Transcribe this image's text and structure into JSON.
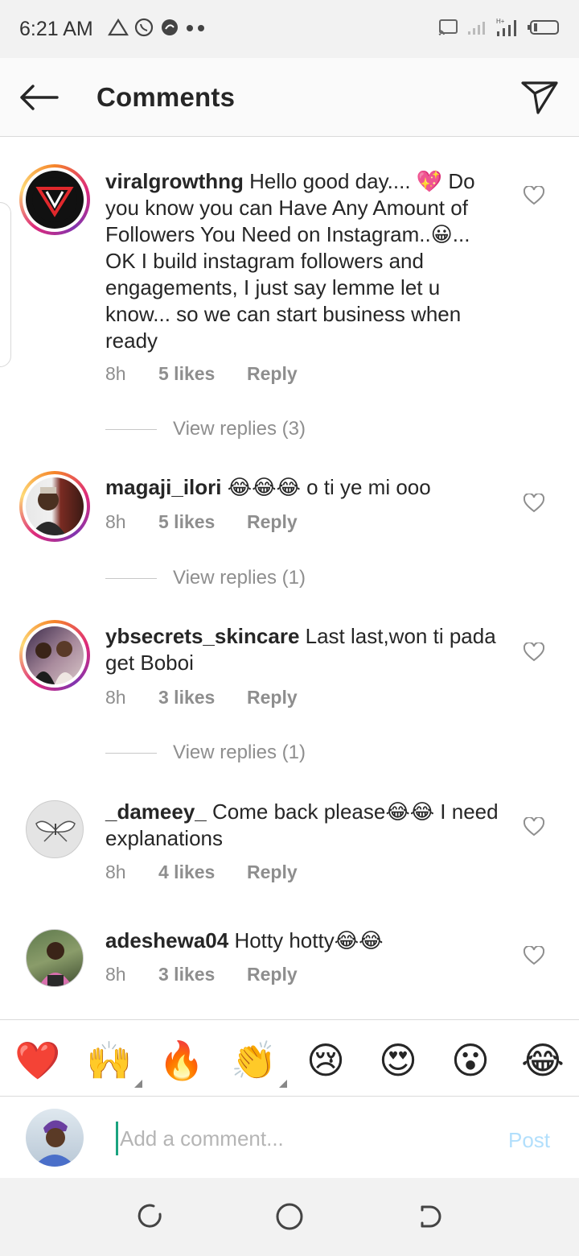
{
  "status_bar": {
    "time": "6:21 AM",
    "notification_icons": [
      "alert-triangle-icon",
      "whatsapp-icon",
      "app-icon"
    ],
    "right_icons": [
      "cast-icon",
      "signal-icon",
      "signal-icon",
      "battery-icon"
    ],
    "network_label": "H+"
  },
  "header": {
    "title": "Comments",
    "back_icon": "arrow-left-icon",
    "share_icon": "paper-plane-icon"
  },
  "comments": [
    {
      "username": "viralgrowthng",
      "text": " Hello good day.... 💖 Do you know you can Have Any Amount of Followers You Need on Instagram..😀... OK I build instagram followers and engagements, I just say lemme let u know... so we can start business when ready",
      "time": "8h",
      "likes": "5 likes",
      "reply": "Reply",
      "view_replies": "View replies (3)"
    },
    {
      "username": "magaji_ilori",
      "text": " 😂😂😂 o ti ye mi ooo",
      "time": "8h",
      "likes": "5 likes",
      "reply": "Reply",
      "view_replies": "View replies (1)"
    },
    {
      "username": "ybsecrets_skincare",
      "text": " Last last,won ti pada get Boboi",
      "time": "8h",
      "likes": "3 likes",
      "reply": "Reply",
      "view_replies": "View replies (1)"
    },
    {
      "username": "_dameey_",
      "text": " Come back please😂😂 I need explanations",
      "time": "8h",
      "likes": "4 likes",
      "reply": "Reply"
    },
    {
      "username": "adeshewa04",
      "text": " Hotty hotty😂😂",
      "time": "8h",
      "likes": "3 likes",
      "reply": "Reply"
    }
  ],
  "reactions": [
    "❤️",
    "🙌",
    "🔥",
    "👏",
    "😢",
    "😍",
    "😮",
    "😂"
  ],
  "composer": {
    "placeholder": "Add a comment...",
    "post_label": "Post"
  },
  "nav_bar": {
    "buttons": [
      "recents-icon",
      "home-icon",
      "back-icon"
    ]
  },
  "colors": {
    "accent_blue_disabled": "#b2dffc",
    "meta_gray": "#8e8e8e",
    "text": "#262626"
  }
}
